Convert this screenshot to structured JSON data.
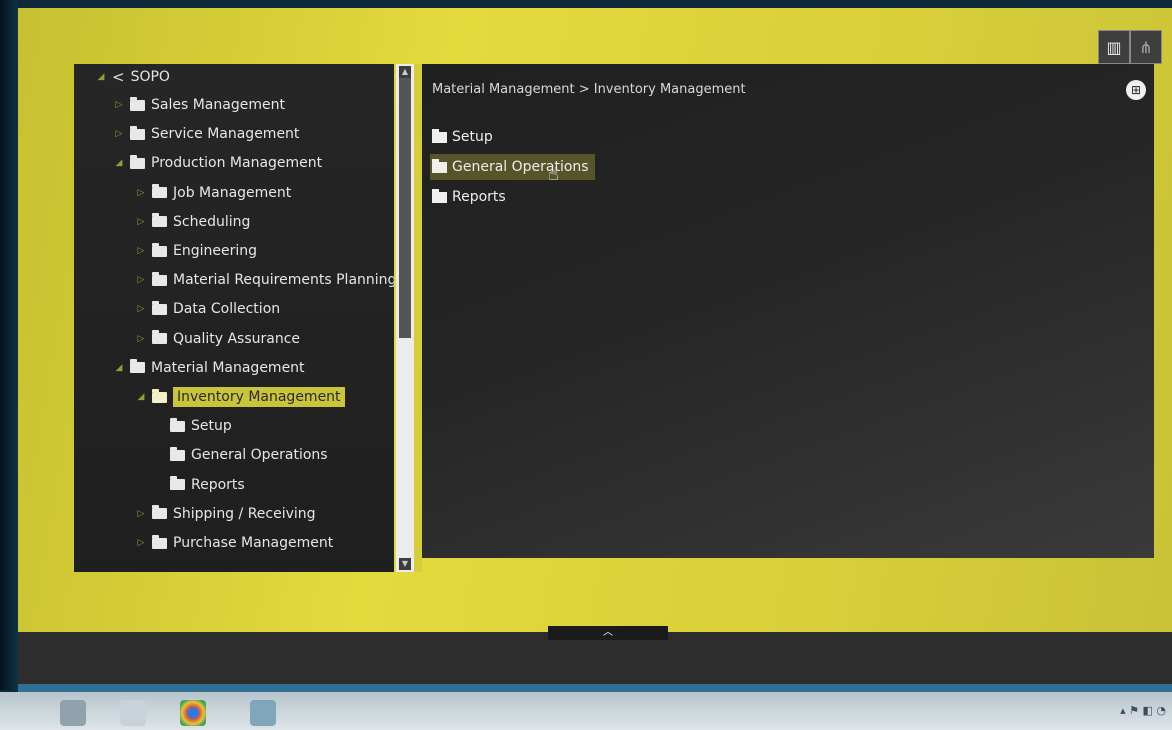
{
  "tree": {
    "root": "SOPO",
    "items": [
      {
        "label": "Sales Management",
        "level": 1,
        "expanded": false
      },
      {
        "label": "Service Management",
        "level": 1,
        "expanded": false
      },
      {
        "label": "Production Management",
        "level": 1,
        "expanded": true
      },
      {
        "label": "Job Management",
        "level": 2,
        "expanded": false
      },
      {
        "label": "Scheduling",
        "level": 2,
        "expanded": false
      },
      {
        "label": "Engineering",
        "level": 2,
        "expanded": false
      },
      {
        "label": "Material Requirements Planning",
        "level": 2,
        "expanded": false
      },
      {
        "label": "Data Collection",
        "level": 2,
        "expanded": false
      },
      {
        "label": "Quality Assurance",
        "level": 2,
        "expanded": false
      },
      {
        "label": "Material Management",
        "level": 1,
        "expanded": true
      },
      {
        "label": "Inventory Management",
        "level": 2,
        "expanded": true,
        "selected": true
      },
      {
        "label": "Setup",
        "level": 3,
        "expanded": false
      },
      {
        "label": "General Operations",
        "level": 3,
        "expanded": false
      },
      {
        "label": "Reports",
        "level": 3,
        "expanded": false
      },
      {
        "label": "Shipping / Receiving",
        "level": 2,
        "expanded": false
      },
      {
        "label": "Purchase Management",
        "level": 2,
        "expanded": false
      }
    ]
  },
  "main": {
    "breadcrumb": "Material Management > Inventory Management",
    "items": [
      {
        "label": "Setup"
      },
      {
        "label": "General Operations",
        "hover": true
      },
      {
        "label": "Reports"
      }
    ]
  },
  "toolbar": {
    "list_view_icon": "list-view-icon",
    "tree_view_icon": "tree-view-icon"
  },
  "colors": {
    "accent": "#c9c43b",
    "panel_bg": "#262626"
  }
}
